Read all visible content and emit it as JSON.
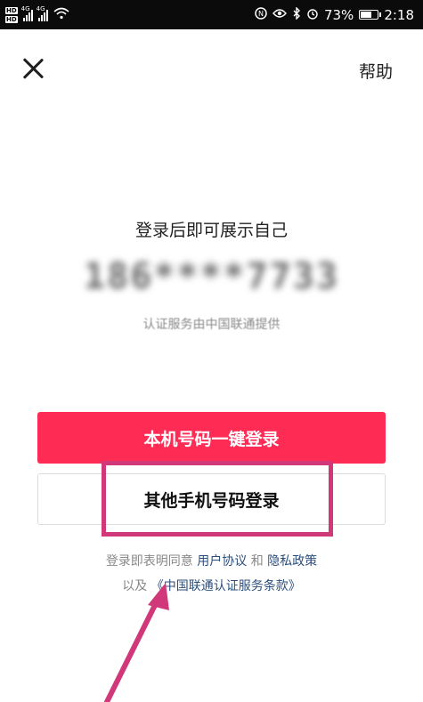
{
  "status_bar": {
    "hd1": "HD",
    "hd2": "HD",
    "net1": "4G",
    "net2": "4G",
    "battery_percent": "73%",
    "battery_level": 0.73,
    "time": "2:18"
  },
  "header": {
    "close_icon": "close-icon",
    "help_label": "帮助"
  },
  "main": {
    "headline": "登录后即可展示自己",
    "masked_phone": "186****7733",
    "provider_note": "认证服务由中国联通提供",
    "one_click_login_label": "本机号码一键登录",
    "other_phone_login_label": "其他手机号码登录"
  },
  "agreement": {
    "prefix": "登录即表明同意 ",
    "user_agreement": "用户协议",
    "and": " 和 ",
    "privacy_policy": "隐私政策",
    "line2_prefix": "以及 ",
    "carrier_terms": "《中国联通认证服务条款》"
  },
  "colors": {
    "primary": "#fe2c55",
    "annotation": "#d1387a",
    "link": "#2c4f7c"
  }
}
